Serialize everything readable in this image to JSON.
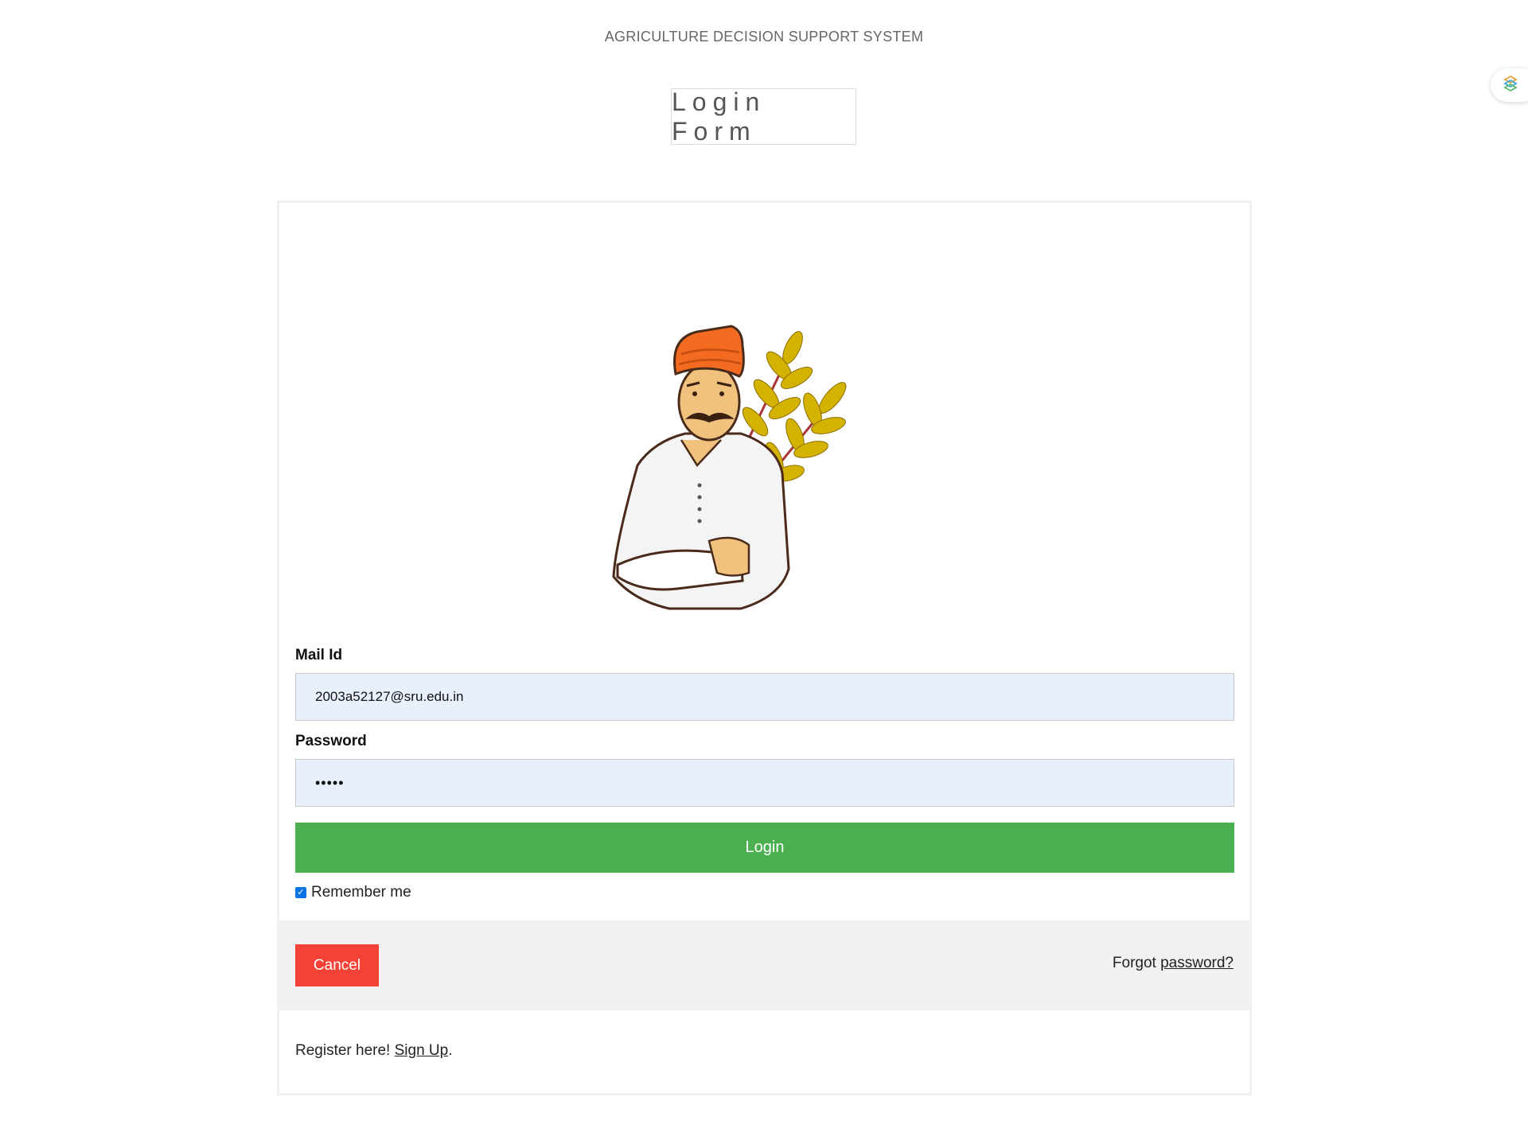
{
  "header": {
    "site_title": "AGRICULTURE DECISION SUPPORT SYSTEM",
    "form_title": "Login Form"
  },
  "login_form": {
    "mail_label": "Mail Id",
    "mail_value": "2003a52127@sru.edu.in",
    "password_label": "Password",
    "password_value": "•••••",
    "login_button": "Login",
    "remember_label": "Remember me",
    "remember_checked": true
  },
  "footer": {
    "cancel_button": "Cancel",
    "forgot_prefix": "Forgot ",
    "forgot_link": "password?",
    "register_prefix": "Register here! ",
    "signup_link": "Sign Up",
    "register_suffix": "."
  },
  "icons": {
    "extension": "extension-icon",
    "illustration": "farmer-illustration"
  },
  "colors": {
    "login_button": "#4caf50",
    "cancel_button": "#f44336",
    "input_background": "#e8f0fe",
    "footer_background": "#f1f1f1"
  }
}
